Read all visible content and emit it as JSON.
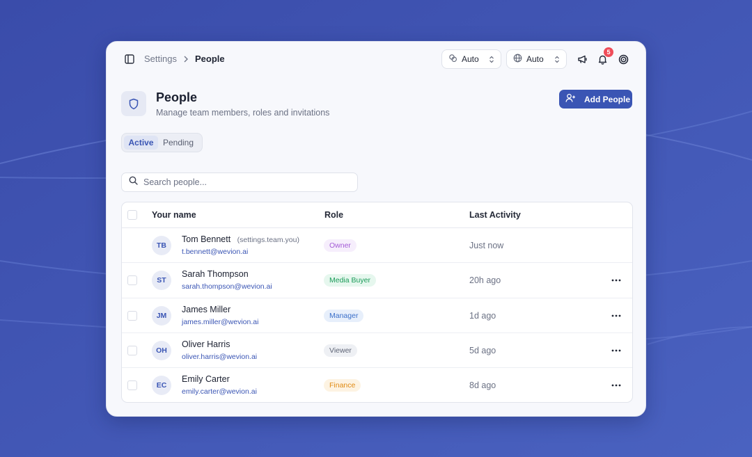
{
  "topbar": {
    "breadcrumb": {
      "parent": "Settings",
      "current": "People"
    },
    "selects": [
      {
        "value": "Auto",
        "icon": "theme-icon"
      },
      {
        "value": "Auto",
        "icon": "globe-icon"
      }
    ],
    "notifications_count": "5"
  },
  "header": {
    "title": "People",
    "subtitle": "Manage team members, roles and invitations",
    "add_button_label": "Add People"
  },
  "tabs": [
    {
      "label": "Active",
      "active": true
    },
    {
      "label": "Pending",
      "active": false
    }
  ],
  "search": {
    "placeholder": "Search people..."
  },
  "table": {
    "columns": {
      "name": "Your name",
      "role": "Role",
      "activity": "Last Activity"
    },
    "rows": [
      {
        "initials": "TB",
        "name": "Tom Bennett",
        "you_tag": "(settings.team.you)",
        "email": "t.bennett@wevion.ai",
        "role": "Owner",
        "activity": "Just now"
      },
      {
        "initials": "ST",
        "name": "Sarah Thompson",
        "email": "sarah.thompson@wevion.ai",
        "role": "Media Buyer",
        "activity": "20h ago"
      },
      {
        "initials": "JM",
        "name": "James Miller",
        "email": "james.miller@wevion.ai",
        "role": "Manager",
        "activity": "1d ago"
      },
      {
        "initials": "OH",
        "name": "Oliver Harris",
        "email": "oliver.harris@wevion.ai",
        "role": "Viewer",
        "activity": "5d ago"
      },
      {
        "initials": "EC",
        "name": "Emily Carter",
        "email": "emily.carter@wevion.ai",
        "role": "Finance",
        "activity": "8d ago"
      }
    ]
  },
  "colors": {
    "background": "#3a4fae",
    "accent": "#3a55b4",
    "badge_red": "#ef4d5a",
    "role_owner_text": "#a35ad6",
    "role_owner_bg": "#f6eefc",
    "role_mediabuyer_text": "#1a9b58",
    "role_mediabuyer_bg": "#e6f7ee",
    "role_manager_text": "#3a6fc9",
    "role_manager_bg": "#e7effb",
    "role_viewer_text": "#5e6475",
    "role_viewer_bg": "#eef0f4",
    "role_finance_text": "#e08a12",
    "role_finance_bg": "#fdf3e2"
  }
}
